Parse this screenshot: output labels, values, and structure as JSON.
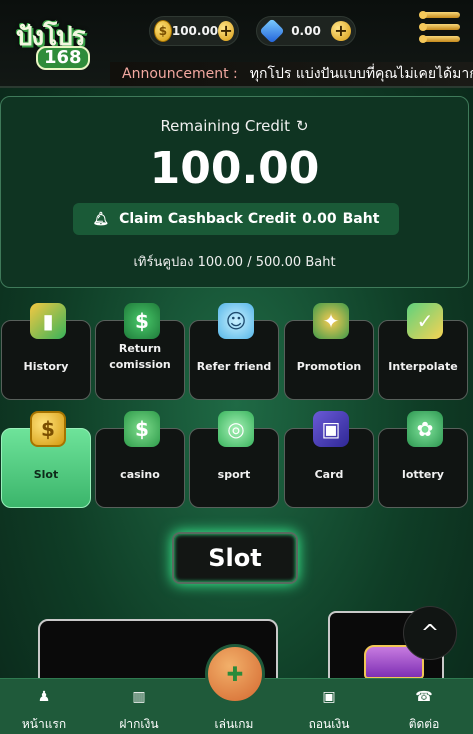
{
  "header": {
    "logo_line1": "ปังโปร",
    "logo_line2": "168",
    "coin_balance": "100.00",
    "gem_balance": "0.00",
    "plus_label": "+",
    "announcement_label": "Announcement :",
    "announcement_text": "ทุกโปร แบ่งปันแบบที่คุณไม่เคยได้มาก่อน"
  },
  "credit": {
    "title": "Remaining Credit",
    "refresh_icon": "↻",
    "amount": "100.00",
    "cashback_label": "Claim Cashback Credit",
    "cashback_amount": "0.00",
    "cashback_unit": "Baht",
    "coupon_text": "เทิร์นคูปอง 100.00 / 500.00 Baht"
  },
  "menu_tiles": [
    {
      "label": "History",
      "icon": "chart-icon",
      "glyph": "▮"
    },
    {
      "label": "Return comission",
      "icon": "money-icon",
      "glyph": "$"
    },
    {
      "label": "Refer friend",
      "icon": "friend-icon",
      "glyph": "☺"
    },
    {
      "label": "Promotion",
      "icon": "gift-icon",
      "glyph": "✦"
    },
    {
      "label": "Interpolate",
      "icon": "clipboard-icon",
      "glyph": "✓"
    }
  ],
  "category_tiles": [
    {
      "label": "Slot",
      "icon": "coin-icon",
      "glyph": "$",
      "active": true
    },
    {
      "label": "casino",
      "icon": "cash-icon",
      "glyph": "$"
    },
    {
      "label": "sport",
      "icon": "ball-icon",
      "glyph": "◎"
    },
    {
      "label": "Card",
      "icon": "wallet-icon",
      "glyph": "▣"
    },
    {
      "label": "lottery",
      "icon": "lottery-icon",
      "glyph": "✿"
    }
  ],
  "section_title": "Slot",
  "scroll_top_icon": "^",
  "bottom_nav": [
    {
      "label": "หน้าแรก",
      "icon": "home-icon",
      "glyph": "♟"
    },
    {
      "label": "ฝากเงิน",
      "icon": "bank-icon",
      "glyph": "▥"
    },
    {
      "label": "เล่นเกม",
      "icon": "game-icon",
      "glyph": "✚"
    },
    {
      "label": "ถอนเงิน",
      "icon": "withdraw-icon",
      "glyph": "▣"
    },
    {
      "label": "ติดต่อ",
      "icon": "contact-icon",
      "glyph": "☎"
    }
  ],
  "colors": {
    "accent_green": "#3bb56b",
    "background": "#0f3d26",
    "gold": "#d49a10"
  }
}
